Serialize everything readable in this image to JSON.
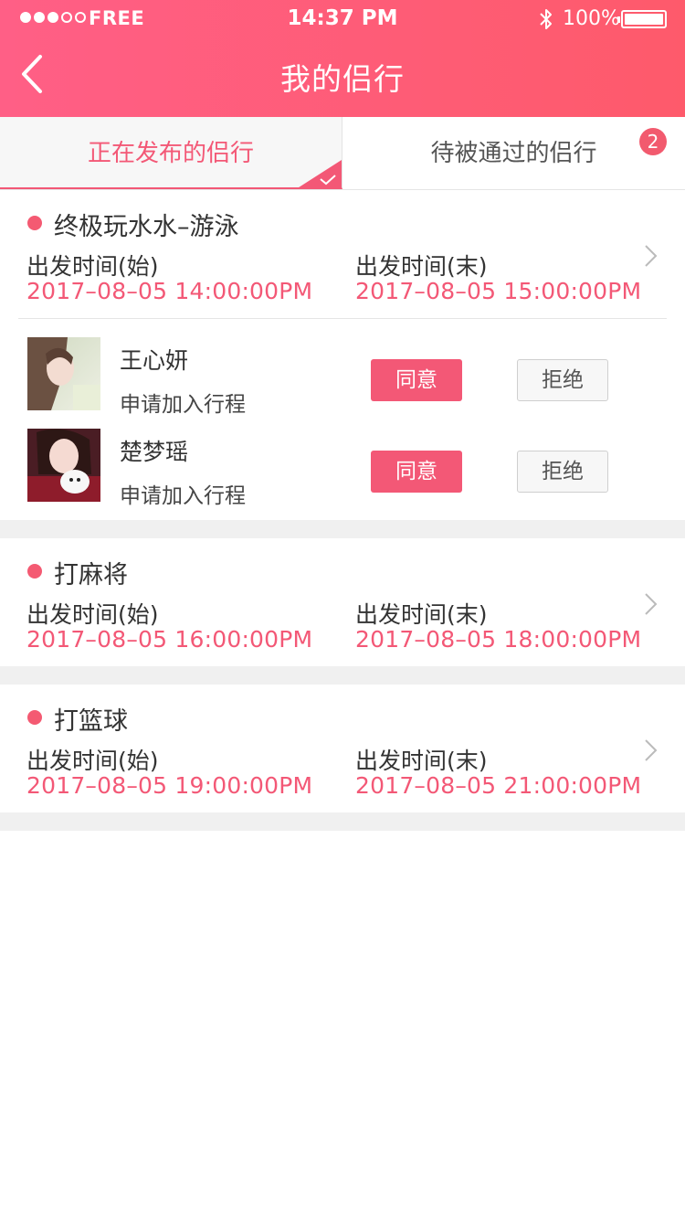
{
  "status_bar": {
    "carrier": "FREE",
    "time": "14:37 PM",
    "battery": "100%",
    "signal_bars_filled": 3,
    "signal_bars_total": 5
  },
  "header": {
    "title": "我的侣行"
  },
  "tabs": [
    {
      "label": "正在发布的侣行",
      "active": true
    },
    {
      "label": "待被通过的侣行",
      "active": false,
      "badge": "2"
    }
  ],
  "trips": [
    {
      "name": "终极玩水水–游泳",
      "start_label": "出发时间(始)",
      "start_time": "2017–08–05 14:00:00PM",
      "end_label": "出发时间(末)",
      "end_time": "2017–08–05 15:00:00PM",
      "requests": [
        {
          "name": "王心妍",
          "note": "申请加入行程",
          "agree": "同意",
          "reject": "拒绝"
        },
        {
          "name": "楚梦瑶",
          "note": "申请加入行程",
          "agree": "同意",
          "reject": "拒绝"
        }
      ]
    },
    {
      "name": "打麻将",
      "start_label": "出发时间(始)",
      "start_time": "2017–08–05 16:00:00PM",
      "end_label": "出发时间(末)",
      "end_time": "2017–08–05 18:00:00PM",
      "requests": []
    },
    {
      "name": "打篮球",
      "start_label": "出发时间(始)",
      "start_time": "2017–08–05 19:00:00PM",
      "end_label": "出发时间(末)",
      "end_time": "2017–08–05 21:00:00PM",
      "requests": []
    }
  ],
  "colors": {
    "accent": "#f35876",
    "header_start": "#ff5f86",
    "header_end": "#fe5a6b"
  }
}
